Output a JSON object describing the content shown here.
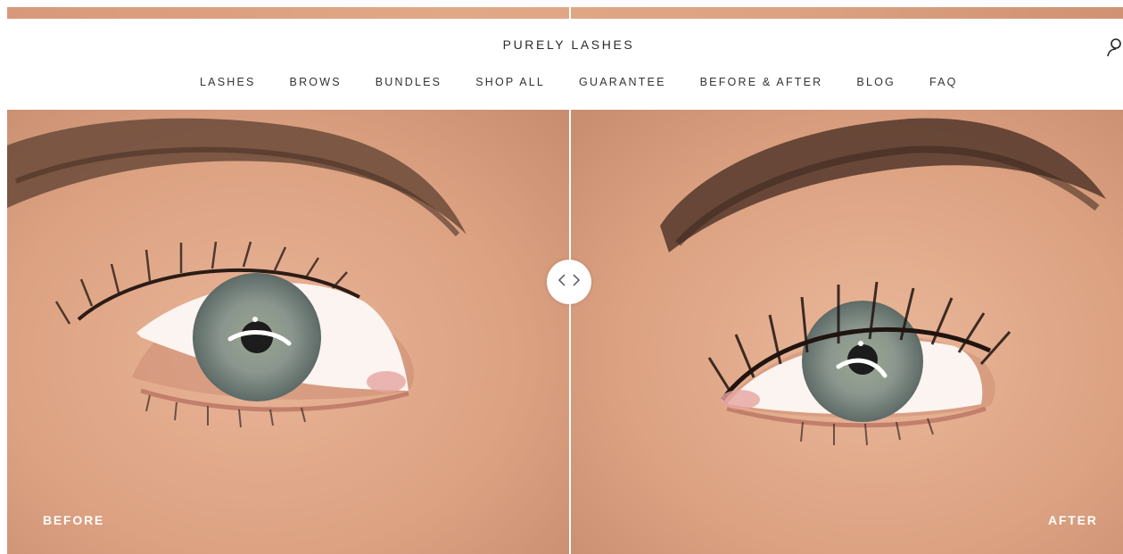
{
  "brand": {
    "name": "PURELY LASHES"
  },
  "nav": {
    "items": [
      {
        "label": "LASHES"
      },
      {
        "label": "BROWS"
      },
      {
        "label": "BUNDLES"
      },
      {
        "label": "SHOP ALL"
      },
      {
        "label": "GUARANTEE"
      },
      {
        "label": "BEFORE & AFTER"
      },
      {
        "label": "BLOG"
      },
      {
        "label": "FAQ"
      }
    ]
  },
  "header": {
    "account_icon": "user-icon"
  },
  "comparison": {
    "before_label": "BEFORE",
    "after_label": "AFTER",
    "handle_icon": "chevron-left-right-icon",
    "slider_position": 0.5
  },
  "colors": {
    "skin": "#dca282",
    "iris": "#7f8f88",
    "text": "#2b2b2b",
    "background": "#ffffff"
  }
}
